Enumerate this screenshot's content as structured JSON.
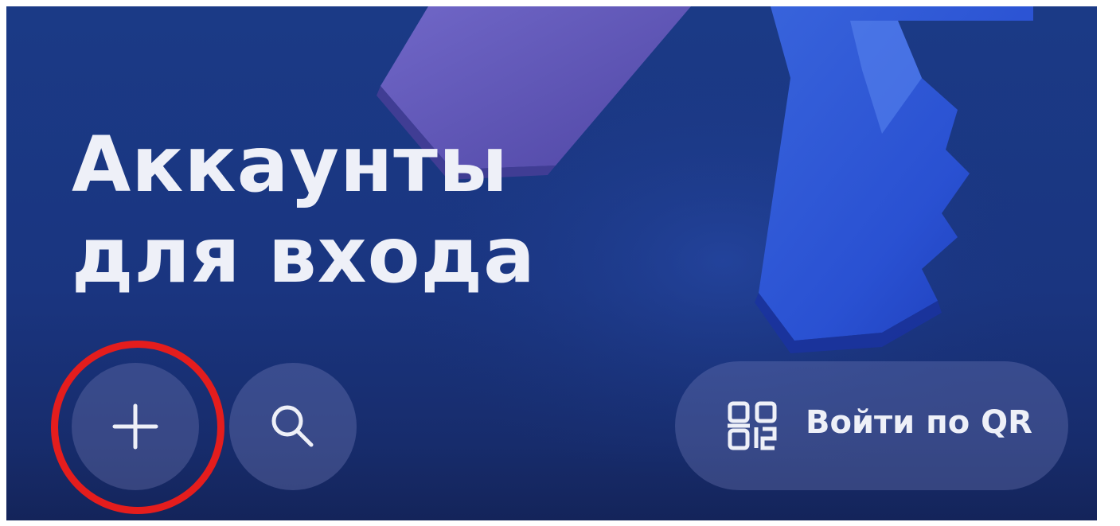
{
  "header": {
    "title_line1": "Аккаунты",
    "title_line2": "для входа"
  },
  "actions": {
    "add_icon": "plus-icon",
    "search_icon": "search-icon",
    "qr_icon": "qr-code-icon",
    "qr_label": "Войти по QR"
  },
  "colors": {
    "background": "#1a3580",
    "highlight_ring": "#e41d1d",
    "text": "#eef0f8"
  }
}
